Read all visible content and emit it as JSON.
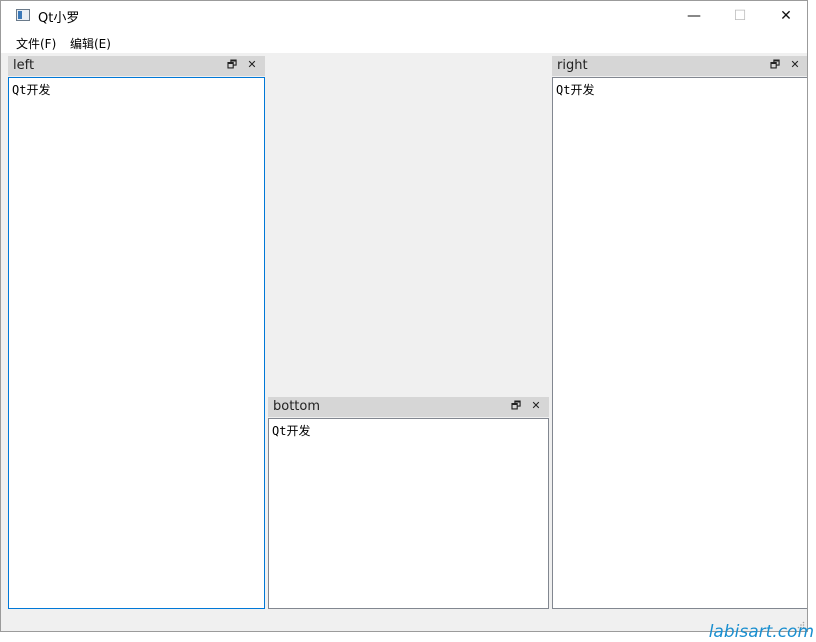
{
  "window": {
    "title": "Qt小罗"
  },
  "controls": {
    "minimize": "—",
    "maximize": "☐",
    "close": "✕"
  },
  "menu": [
    {
      "label": "文件(F)"
    },
    {
      "label": "编辑(E)"
    }
  ],
  "docks": {
    "left": {
      "title": "left",
      "content": "Qt开发"
    },
    "bottom": {
      "title": "bottom",
      "content": "Qt开发"
    },
    "right": {
      "title": "right",
      "content": "Qt开发"
    }
  },
  "dock_buttons": {
    "float": "🗗",
    "close": "✕"
  },
  "watermark": "labisart.com"
}
